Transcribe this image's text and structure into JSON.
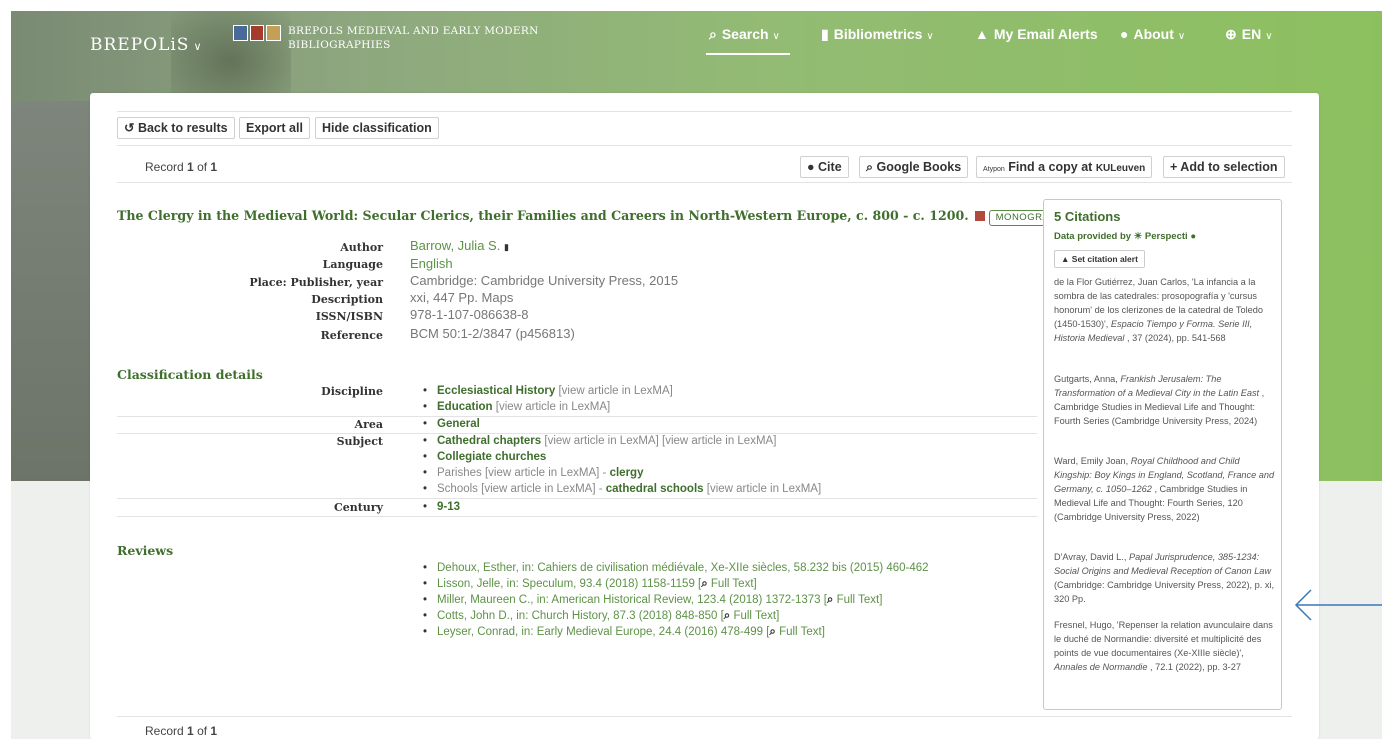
{
  "nav": {
    "brand": "BREPOLiS",
    "bib_title_line1": "BREPOLS MEDIEVAL AND EARLY MODERN",
    "bib_title_line2": "BIBLIOGRAPHIES",
    "items": [
      {
        "label": "Search",
        "icon": "search-icon"
      },
      {
        "label": "Bibliometrics",
        "icon": "bar-chart-icon"
      },
      {
        "label": "My Email Alerts",
        "icon": "bell-icon"
      },
      {
        "label": "About",
        "icon": "info-icon"
      },
      {
        "label": "EN",
        "icon": "globe-icon"
      }
    ]
  },
  "toolbar": {
    "back": "Back to results",
    "export": "Export all",
    "hide": "Hide classification"
  },
  "record": {
    "prefix": "Record",
    "current": "1",
    "of": "of",
    "total": "1"
  },
  "actions": {
    "cite": "Cite",
    "google": "Google Books",
    "atypon": "Atypon",
    "find": "Find a copy at",
    "library": "KULeuven",
    "add": "+ Add to selection"
  },
  "work": {
    "title": "The Clergy in the Medieval World: Secular Clerics, their Families and Careers in North-Western Europe, c. 800 - c. 1200.",
    "type": "MONOGRAPH",
    "fields": [
      {
        "label": "Author",
        "value": "Barrow, Julia S."
      },
      {
        "label": "Language",
        "value": "English"
      },
      {
        "label": "Place: Publisher, year",
        "value": "Cambridge: Cambridge University Press, 2015"
      },
      {
        "label": "Description",
        "value": "xxi, 447 Pp. Maps"
      },
      {
        "label": "ISSN/ISBN",
        "value": "978-1-107-086638-8"
      },
      {
        "label": "Reference",
        "value": "BCM 50:1-2/3847 (p456813)"
      }
    ]
  },
  "classification": {
    "heading": "Classification details",
    "discipline_label": "Discipline",
    "area_label": "Area",
    "subject_label": "Subject",
    "century_label": "Century",
    "eccl": "Ecclesiastical History",
    "education": "Education",
    "general": "General",
    "cathedral_chapters": "Cathedral chapters",
    "collegiate": "Collegiate churches",
    "parishes": "Parishes",
    "clergy": "clergy",
    "schools": "Schools",
    "cathedral_schools": "cathedral schools",
    "century": "9-13",
    "lexma": "[view article in LexMA]",
    "dash": " - "
  },
  "reviews": {
    "heading": "Reviews",
    "full_text": "Full Text",
    "items": [
      "Dehoux, Esther, in: Cahiers de civilisation médiévale, Xe-XIIe siècles, 58.232 bis (2015) 460-462",
      "Lisson, Jelle, in: Speculum, 93.4 (2018) 1158-1159 [",
      "Miller, Maureen C., in: American Historical Review, 123.4 (2018) 1372-1373 [",
      "Cotts, John D., in: Church History, 87.3 (2018) 848-850 [",
      "Leyser, Conrad, in: Early Medieval Europe, 24.4 (2016) 478-499 ["
    ]
  },
  "citations": {
    "heading": "5 Citations",
    "provided_by": "Data provided by",
    "provider": "Perspecti",
    "alert": "Set citation alert",
    "e1_a": "de la Flor Gutiérrez, Juan Carlos, 'La infancia a la sombra de las catedrales: prosopografía y 'cursus honorum' de los clerizones de la catedral de Toledo (1450-1530)', ",
    "e1_i": "Espacio Tiempo y Forma. Serie III, Historia Medieval",
    "e1_b": " , 37 (2024), pp. 541-568",
    "e2_a": "Gutgarts, Anna, ",
    "e2_i": "Frankish Jerusalem: The Transformation of a Medieval City in the Latin East",
    "e2_b": " , Cambridge Studies in Medieval Life and Thought: Fourth Series (Cambridge University Press, 2024)",
    "e3_a": "Ward, Emily Joan, ",
    "e3_i": "Royal Childhood and Child Kingship: Boy Kings in England, Scotland, France and Germany, c. 1050–1262",
    "e3_b": " , Cambridge Studies in Medieval Life and Thought: Fourth Series, 120 (Cambridge University Press, 2022)",
    "e4_a": "D'Avray, David L., ",
    "e4_i": "Papal Jurisprudence, 385-1234: Social Origins and Medieval Reception of Canon Law",
    "e4_b": " (Cambridge: Cambridge University Press, 2022), p. xi, 320 Pp.",
    "e5_a": "Fresnel, Hugo, 'Repenser la relation avunculaire dans le duché de Normandie: diversité et multiplicité des points de vue documentaires (Xe-XIIIe siècle)', ",
    "e5_i": "Annales de Normandie",
    "e5_b": " , 72.1 (2022), pp. 3-27"
  }
}
